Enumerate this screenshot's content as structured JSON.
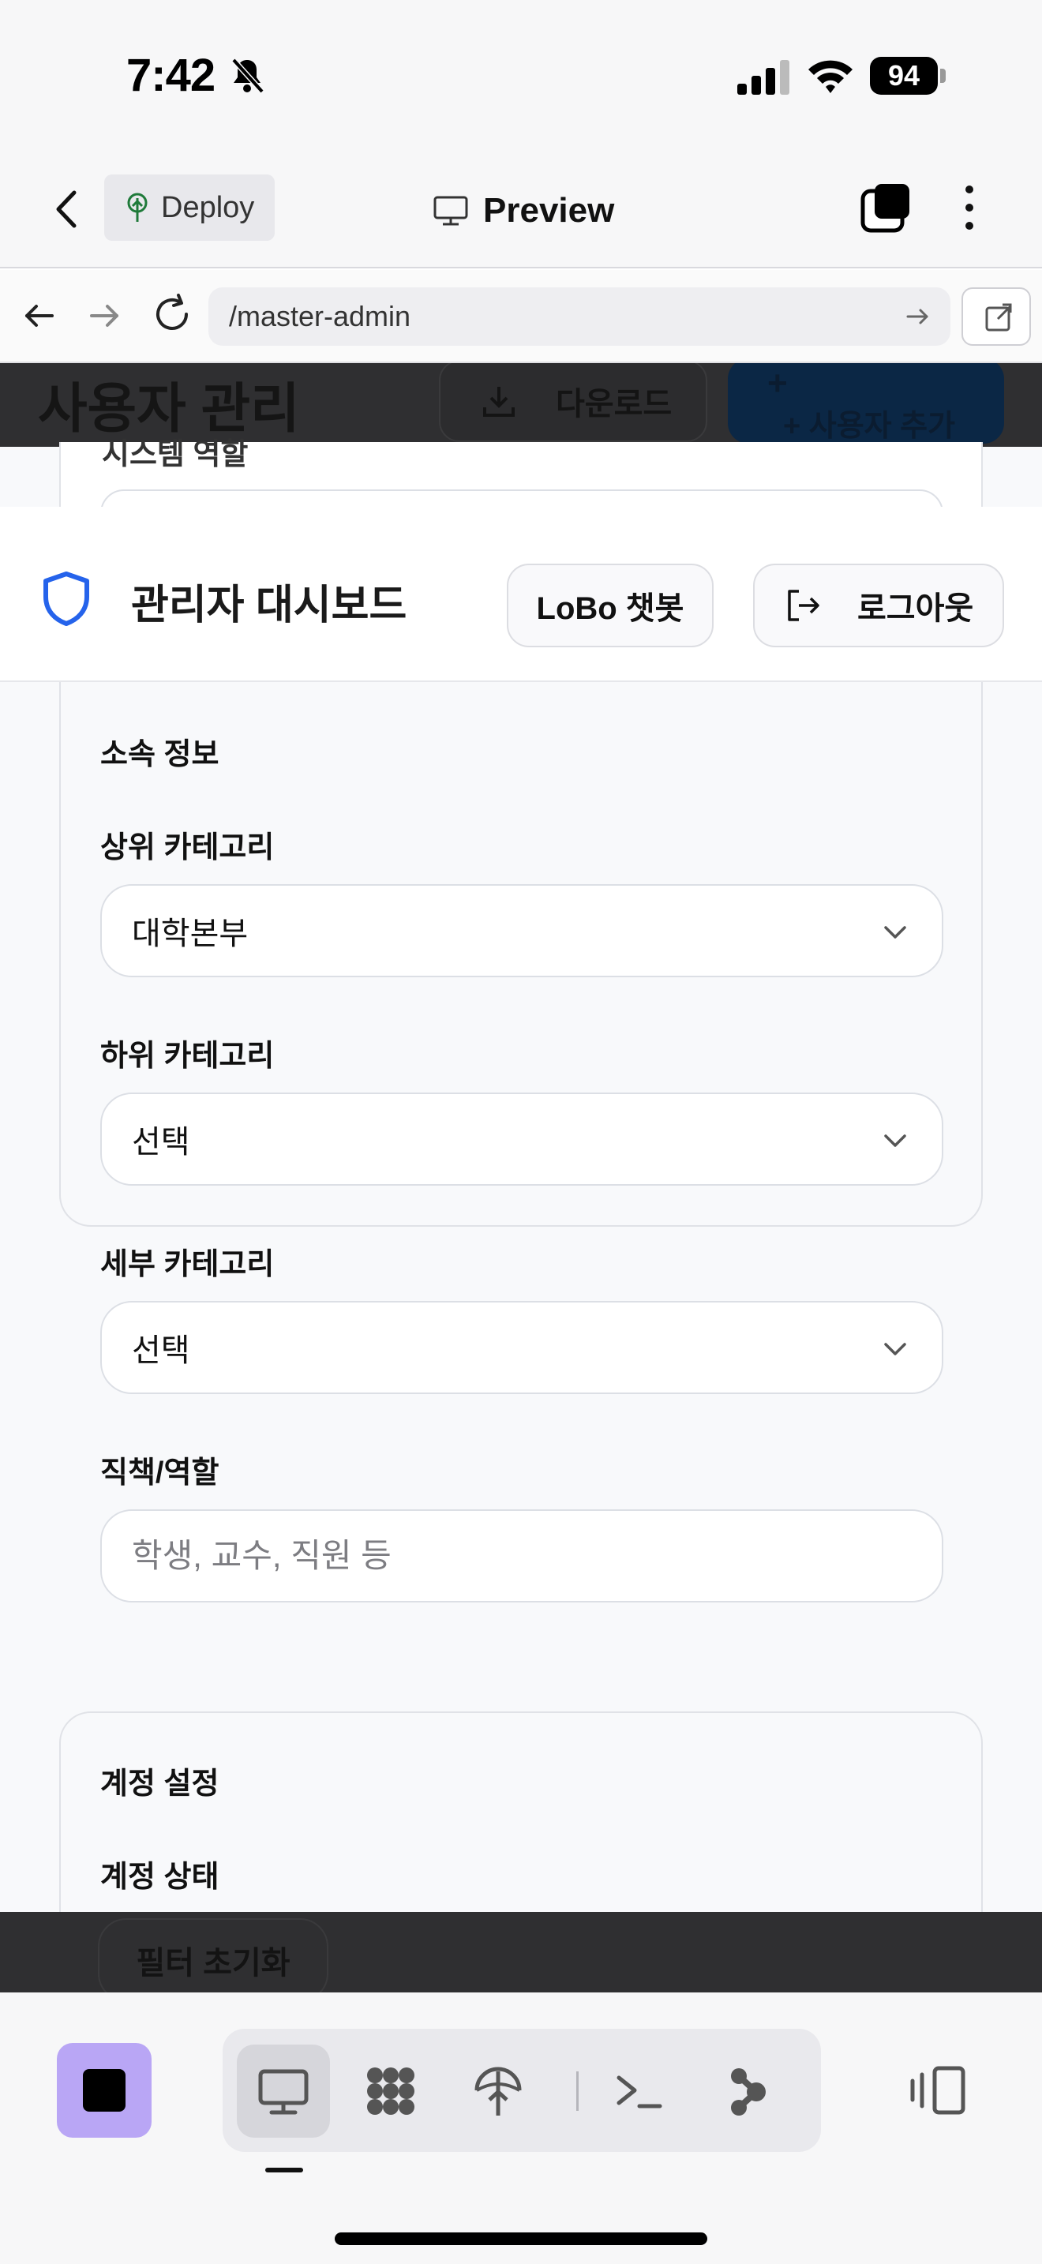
{
  "status_bar": {
    "time": "7:42",
    "battery": "94"
  },
  "app_bar": {
    "deploy_label": "Deploy",
    "preview_title": "Preview"
  },
  "browser": {
    "url": "/master-admin"
  },
  "page": {
    "title": "사용자 관리",
    "download_label": "다운로드",
    "add_user_plus": "+",
    "add_user_label": "+ 사용자 추가",
    "partial_label": "시스템 역할",
    "reset_filter_label": "필터 초기화"
  },
  "header": {
    "title": "관리자 대시보드",
    "chatbot_label": "LoBo 챗봇",
    "logout_label": "로그아웃"
  },
  "affiliation": {
    "title": "소속 정보",
    "top_category": {
      "label": "상위 카테고리",
      "value": "대학본부"
    },
    "sub_category": {
      "label": "하위 카테고리",
      "value": "선택"
    },
    "detail_category": {
      "label": "세부 카테고리",
      "value": "선택"
    },
    "position": {
      "label": "직책/역할",
      "placeholder": "학생, 교수, 직원 등"
    }
  },
  "account": {
    "title": "계정 설정",
    "status_label": "계정 상태"
  },
  "colors": {
    "accent": "#2563eb",
    "stop_button": "#b9a6f5",
    "overlay": "#2f2f31"
  }
}
